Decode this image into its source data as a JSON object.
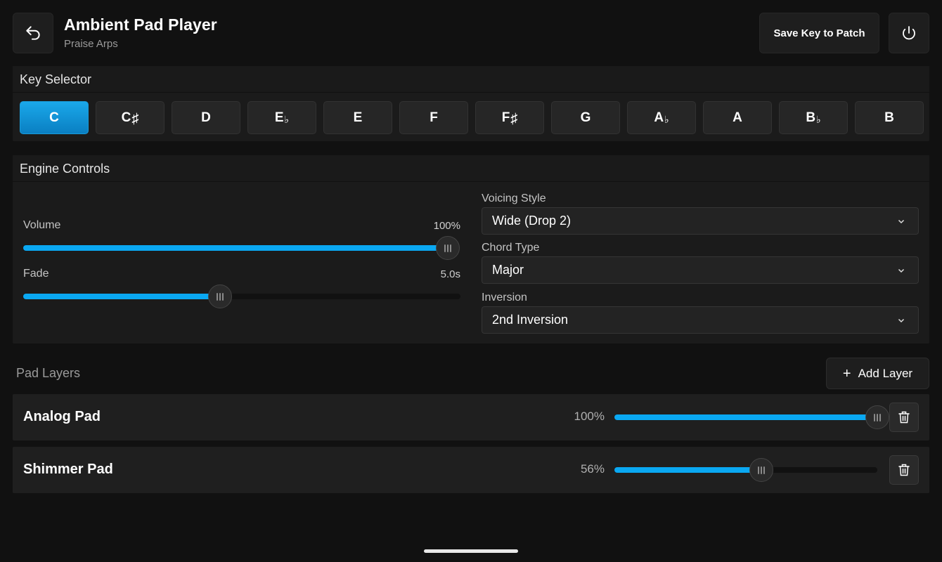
{
  "header": {
    "title": "Ambient Pad Player",
    "subtitle": "Praise Arps",
    "save_label": "Save Key to Patch",
    "back_icon": "undo-arrow-icon",
    "power_icon": "power-icon"
  },
  "key_selector": {
    "title": "Key Selector",
    "selected": "C",
    "keys": [
      {
        "root": "C",
        "accidental": ""
      },
      {
        "root": "C",
        "accidental": "♯"
      },
      {
        "root": "D",
        "accidental": ""
      },
      {
        "root": "E",
        "accidental": "♭"
      },
      {
        "root": "E",
        "accidental": ""
      },
      {
        "root": "F",
        "accidental": ""
      },
      {
        "root": "F",
        "accidental": "♯"
      },
      {
        "root": "G",
        "accidental": ""
      },
      {
        "root": "A",
        "accidental": "♭"
      },
      {
        "root": "A",
        "accidental": ""
      },
      {
        "root": "B",
        "accidental": "♭"
      },
      {
        "root": "B",
        "accidental": ""
      }
    ]
  },
  "engine": {
    "title": "Engine Controls",
    "volume": {
      "label": "Volume",
      "value_text": "100%",
      "fraction": 1.0
    },
    "fade": {
      "label": "Fade",
      "value_text": "5.0s",
      "fraction": 0.45
    },
    "voicing": {
      "label": "Voicing Style",
      "value": "Wide (Drop 2)"
    },
    "chord_type": {
      "label": "Chord Type",
      "value": "Major"
    },
    "inversion": {
      "label": "Inversion",
      "value": "2nd Inversion"
    }
  },
  "layers": {
    "title": "Pad Layers",
    "add_label": "Add Layer",
    "items": [
      {
        "name": "Analog Pad",
        "percent_text": "100%",
        "fraction": 1.0
      },
      {
        "name": "Shimmer Pad",
        "percent_text": "56%",
        "fraction": 0.56
      }
    ]
  },
  "colors": {
    "accent": "#0aa8f2",
    "background": "#111111",
    "panel": "#1b1b1b"
  }
}
